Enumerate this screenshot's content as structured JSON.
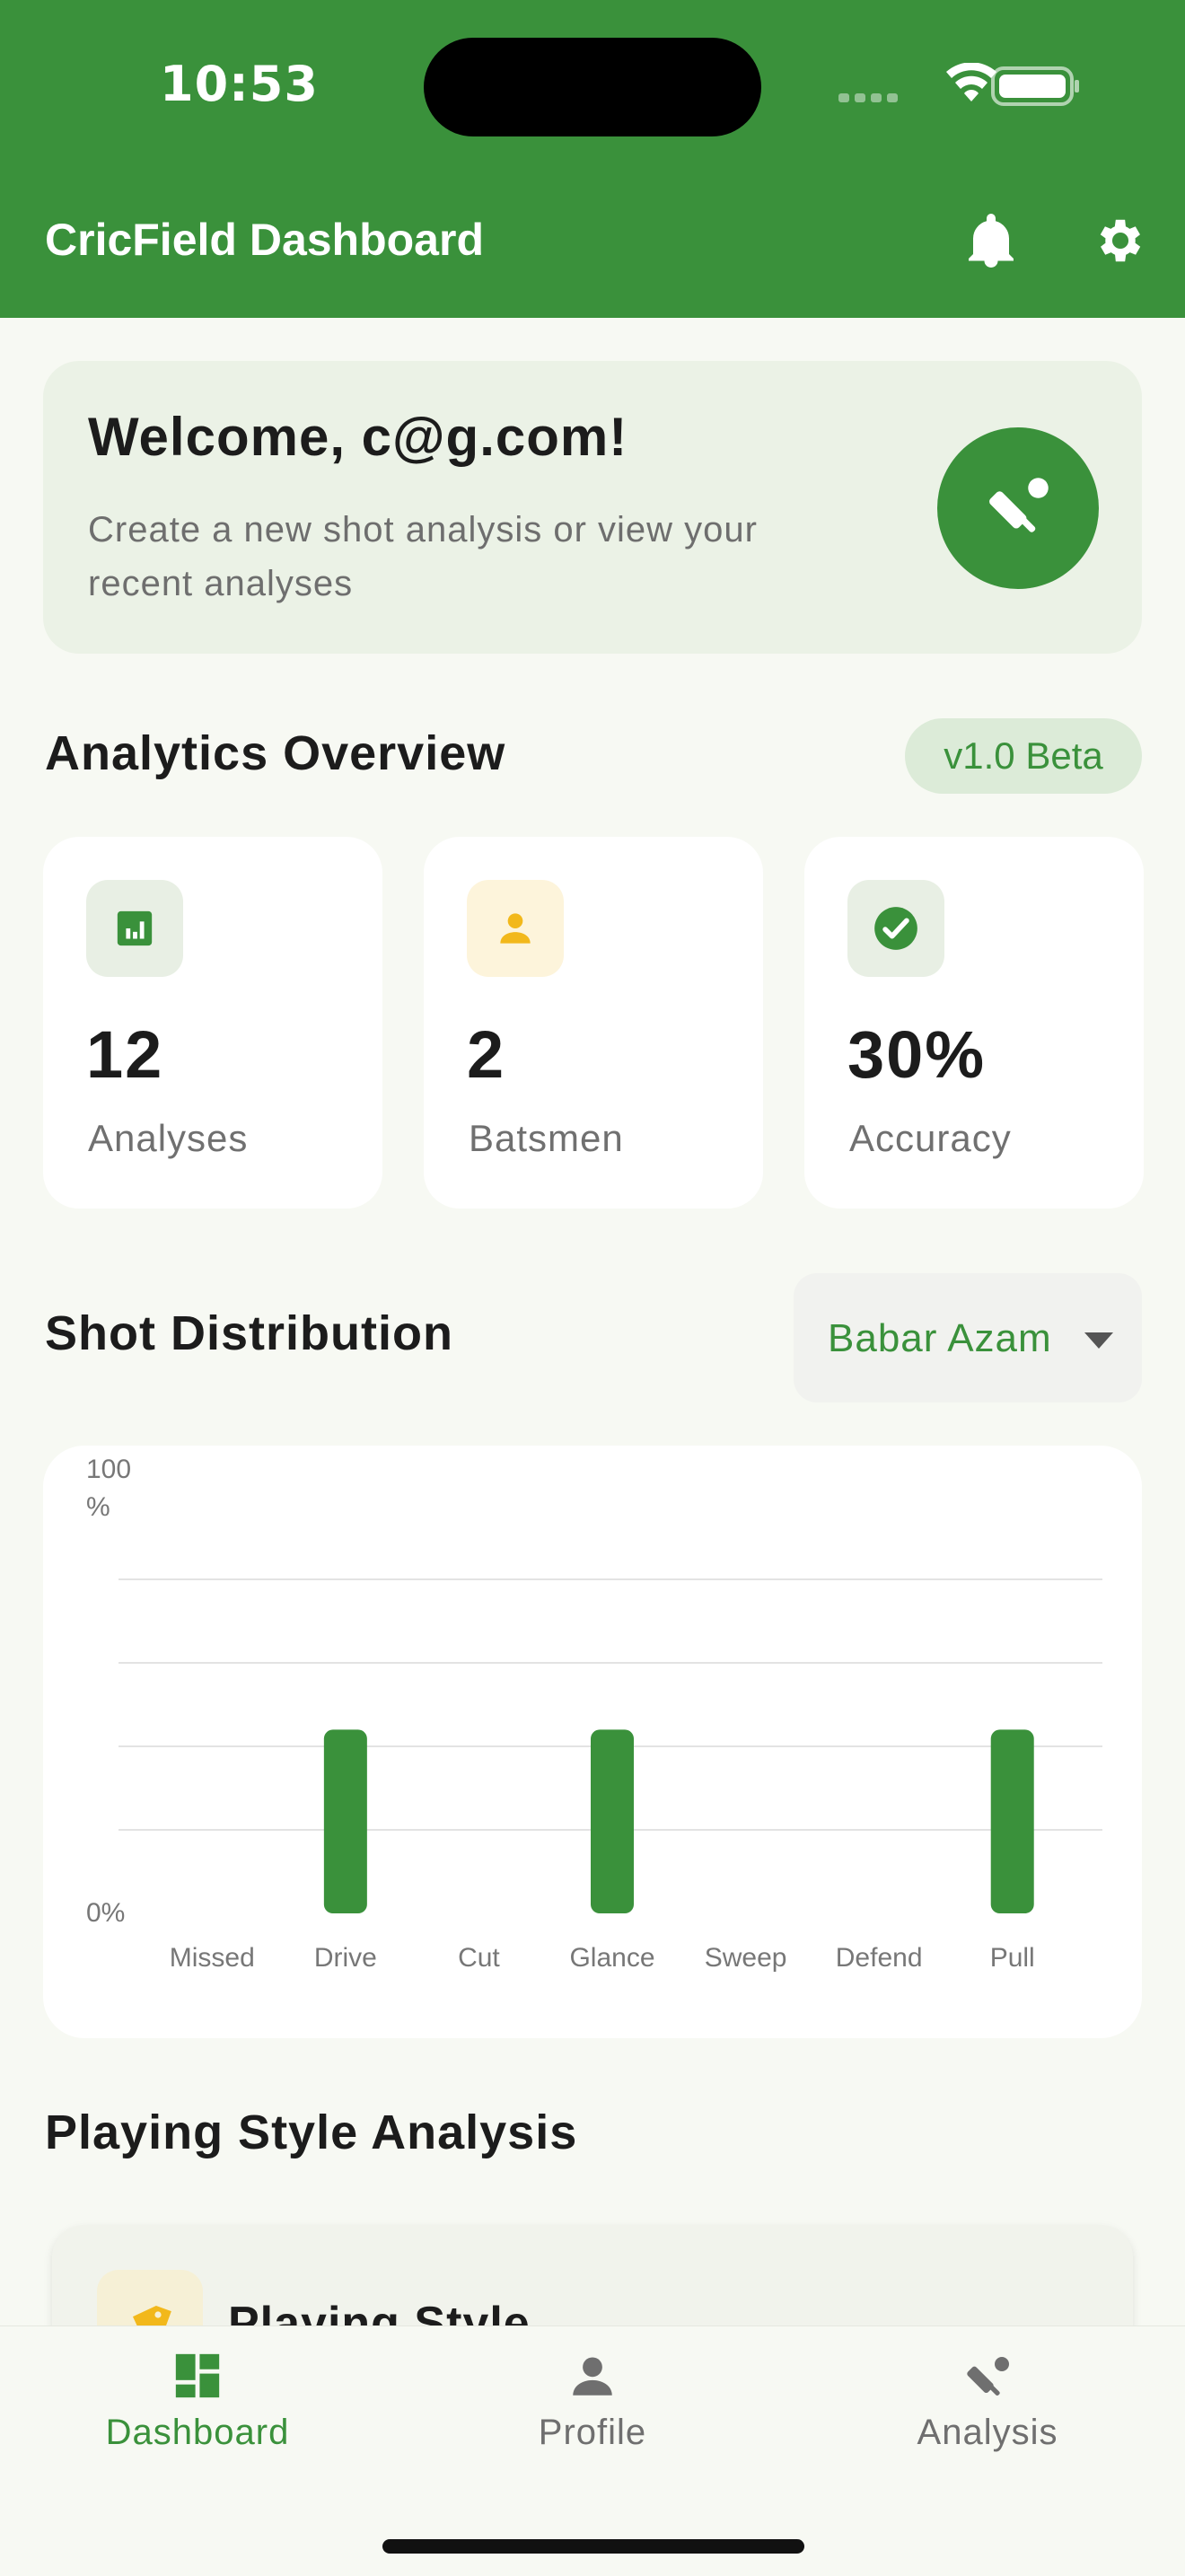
{
  "status_bar": {
    "time": "10:53"
  },
  "header": {
    "title": "CricField Dashboard",
    "icons": [
      "bell-icon",
      "gear-icon"
    ]
  },
  "welcome": {
    "title": "Welcome, c@g.com!",
    "subtitle": "Create a new shot analysis or view your recent analyses",
    "icon": "cricket-icon"
  },
  "analytics": {
    "title": "Analytics Overview",
    "badge": "v1.0 Beta",
    "stats": [
      {
        "value": "12",
        "label": "Analyses",
        "icon": "bar-chart-icon",
        "color": "#3a913b"
      },
      {
        "value": "2",
        "label": "Batsmen",
        "icon": "person-icon",
        "color": "#f2b81b"
      },
      {
        "value": "30%",
        "label": "Accuracy",
        "icon": "check-circle-icon",
        "color": "#3a913b"
      }
    ]
  },
  "shot_distribution": {
    "title": "Shot Distribution",
    "selected_batsman": "Babar Azam"
  },
  "chart_data": {
    "type": "bar",
    "categories": [
      "Missed",
      "Drive",
      "Cut",
      "Glance",
      "Sweep",
      "Defend",
      "Pull"
    ],
    "values": [
      0,
      33,
      0,
      33,
      0,
      0,
      33
    ],
    "y_top_label": "100 %",
    "y_bottom_label": "0%",
    "ylim": [
      0,
      100
    ],
    "grid": true,
    "bar_color": "#3a913b"
  },
  "playing_style": {
    "section_title": "Playing Style Analysis",
    "card_title": "Playing Style",
    "icon": "tag-icon"
  },
  "bottom_nav": {
    "items": [
      {
        "label": "Dashboard",
        "icon": "dashboard-icon",
        "active": true
      },
      {
        "label": "Profile",
        "icon": "person-icon",
        "active": false
      },
      {
        "label": "Analysis",
        "icon": "cricket-icon",
        "active": false
      }
    ]
  },
  "colors": {
    "primary": "#3a913b",
    "background": "#f7f9f3",
    "muted_text": "#707070"
  }
}
